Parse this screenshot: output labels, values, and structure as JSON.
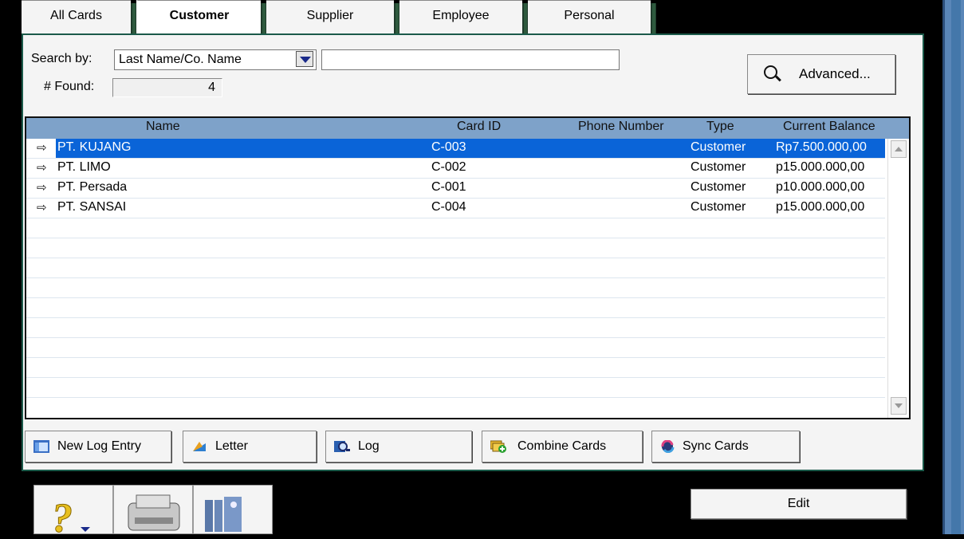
{
  "tabs": [
    {
      "label": "All Cards",
      "active": false
    },
    {
      "label": "Customer",
      "active": true
    },
    {
      "label": "Supplier",
      "active": false
    },
    {
      "label": "Employee",
      "active": false
    },
    {
      "label": "Personal",
      "active": false
    }
  ],
  "search": {
    "label": "Search by:",
    "field_value": "Last Name/Co. Name",
    "text_value": "",
    "found_label": "# Found:",
    "found_count": "4",
    "advanced_label": "Advanced..."
  },
  "table": {
    "columns": [
      "Name",
      "Card ID",
      "Phone Number",
      "Type",
      "Current Balance"
    ],
    "rows": [
      {
        "name": "PT. KUJANG",
        "card_id": "C-003",
        "phone": "",
        "type": "Customer",
        "balance": "Rp7.500.000,00",
        "selected": true
      },
      {
        "name": "PT. LIMO",
        "card_id": "C-002",
        "phone": "",
        "type": "Customer",
        "balance": "p15.000.000,00",
        "selected": false
      },
      {
        "name": "PT. Persada",
        "card_id": "C-001",
        "phone": "",
        "type": "Customer",
        "balance": "p10.000.000,00",
        "selected": false
      },
      {
        "name": "PT. SANSAI",
        "card_id": "C-004",
        "phone": "",
        "type": "Customer",
        "balance": "p15.000.000,00",
        "selected": false
      }
    ]
  },
  "actions": {
    "new_log_entry": "New Log Entry",
    "letter": "Letter",
    "log": "Log",
    "combine_cards": "Combine Cards",
    "sync_cards": "Sync Cards"
  },
  "edit_label": "Edit",
  "colors": {
    "selection": "#0a64d8",
    "header": "#7ea2c9",
    "panel_border": "#1b5a4a"
  }
}
